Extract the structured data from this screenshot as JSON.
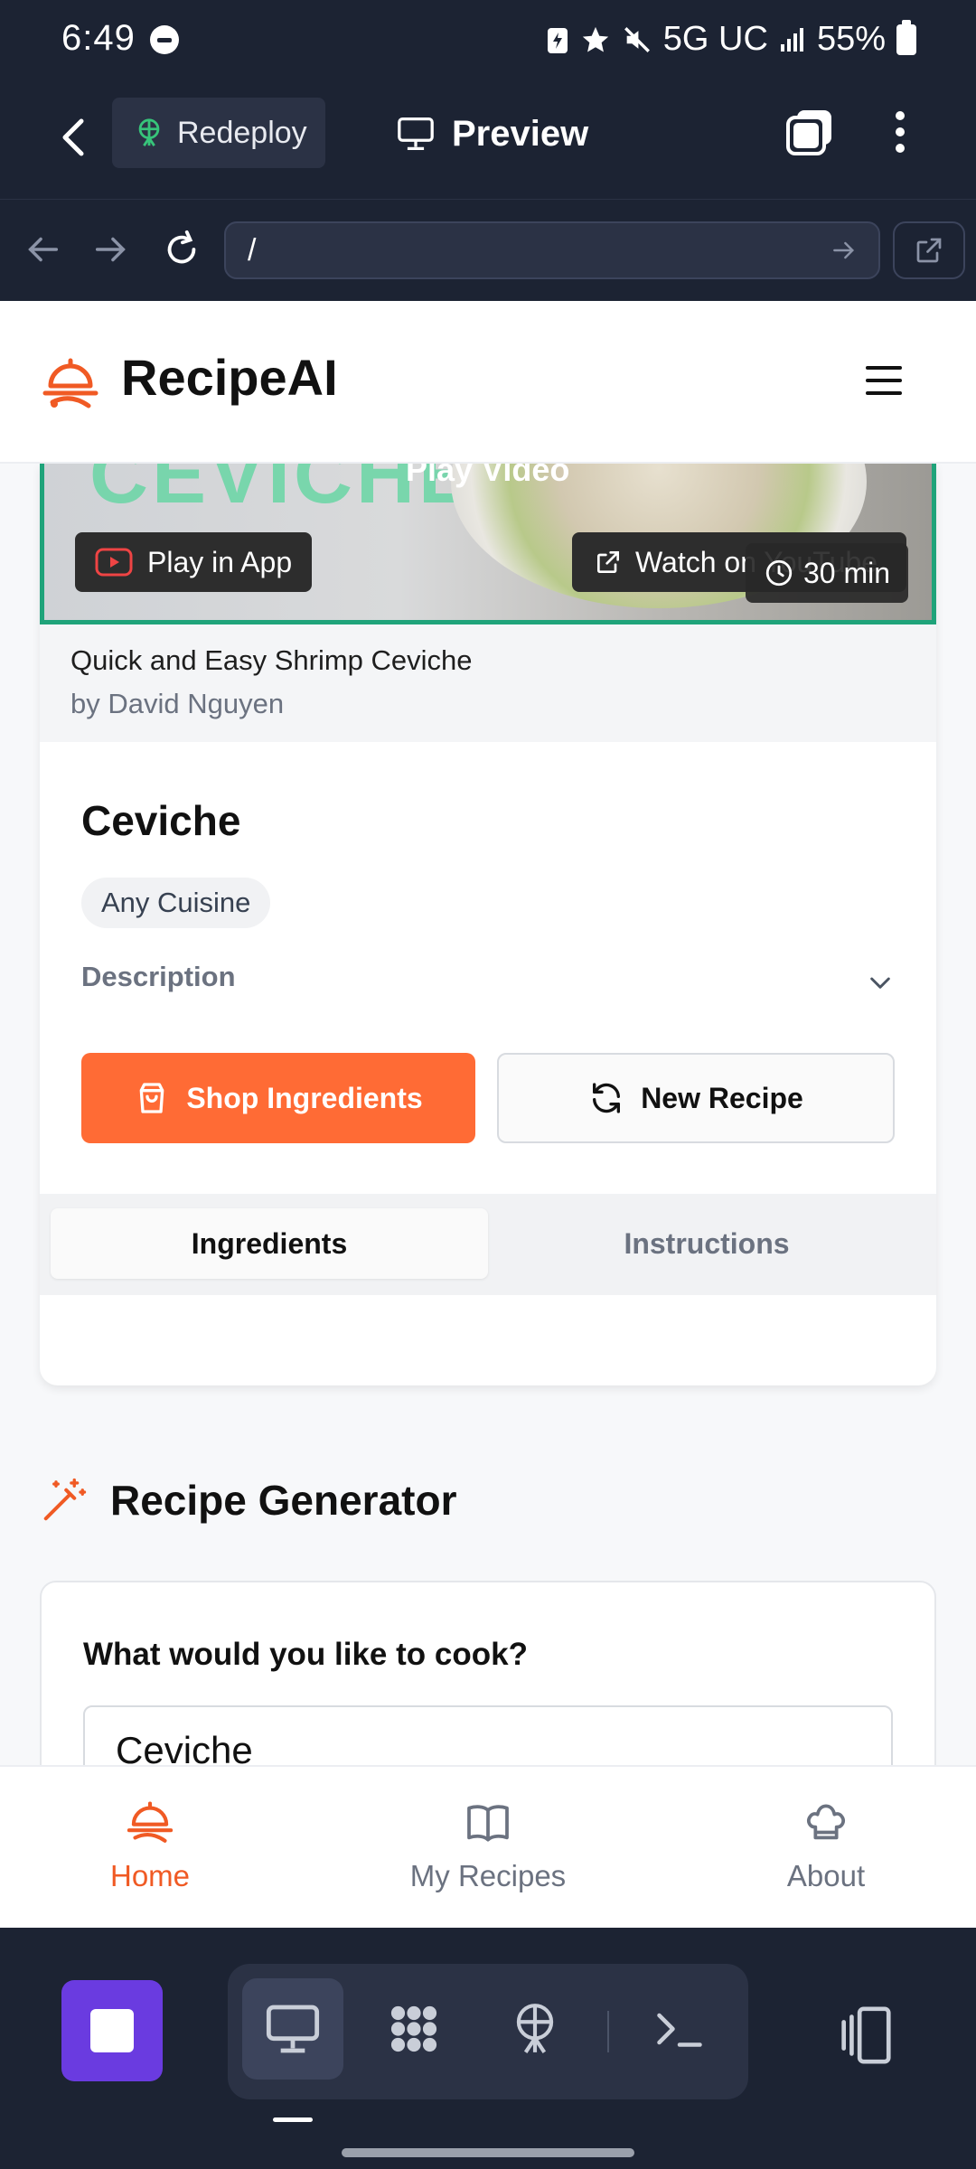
{
  "status_bar": {
    "time": "6:49",
    "network": "5G UC",
    "battery": "55%"
  },
  "topbar": {
    "redeploy_label": "Redeploy",
    "preview_label": "Preview"
  },
  "urlbar": {
    "url": "/"
  },
  "app": {
    "name": "RecipeAI",
    "accent_color": "#ff6b35",
    "video": {
      "overlay_text": "Play Video",
      "art_text": "CEVICHE",
      "play_in_app_label": "Play in App",
      "youtube_label": "Watch on YouTube",
      "duration": "30 min",
      "title": "Quick and Easy Shrimp Ceviche",
      "author": "by David Nguyen"
    },
    "recipe": {
      "title": "Ceviche",
      "cuisine": "Any Cuisine",
      "description_label": "Description",
      "shop_label": "Shop Ingredients",
      "new_recipe_label": "New Recipe",
      "tabs": [
        {
          "label": "Ingredients",
          "active": true
        },
        {
          "label": "Instructions",
          "active": false
        }
      ]
    },
    "generator": {
      "heading": "Recipe Generator",
      "question": "What would you like to cook?",
      "input_value": "Ceviche"
    },
    "nav": [
      {
        "label": "Home",
        "icon": "chef-logo-icon",
        "active": true
      },
      {
        "label": "My Recipes",
        "icon": "book-icon",
        "active": false
      },
      {
        "label": "About",
        "icon": "chef-hat-icon",
        "active": false
      }
    ]
  },
  "toolbar": {
    "icons": [
      "stop-icon",
      "monitor-icon",
      "extensions-icon",
      "deploy-icon",
      "terminal-icon",
      "devices-icon"
    ]
  }
}
